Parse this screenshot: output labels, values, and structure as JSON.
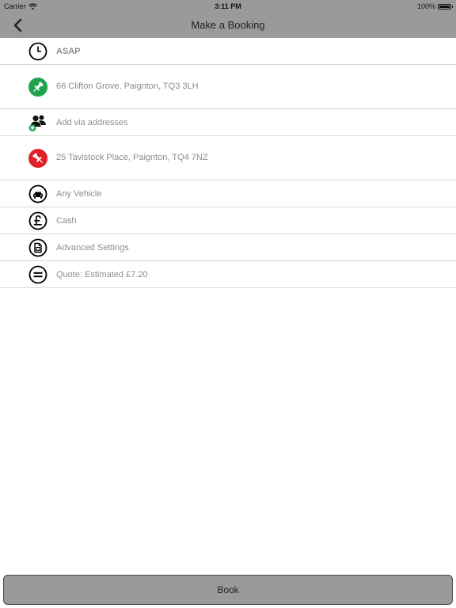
{
  "status_bar": {
    "carrier": "Carrier",
    "time": "3:11 PM",
    "battery": "100%"
  },
  "nav": {
    "title": "Make a Booking",
    "back_icon": "chevron-left-icon"
  },
  "rows": [
    {
      "name": "asap",
      "icon": "clock-icon",
      "label": "ASAP"
    },
    {
      "name": "pickup-address",
      "icon": "green-pin-icon",
      "label": "66 Clifton Grove, Paignton, TQ3 3LH"
    },
    {
      "name": "via-addresses",
      "icon": "people-add-icon",
      "label": "Add via addresses"
    },
    {
      "name": "dropoff-address",
      "icon": "red-pin-icon",
      "label": "25 Tavistock Place, Paignton, TQ4 7NZ"
    },
    {
      "name": "vehicle",
      "icon": "car-icon",
      "label": "Any Vehicle"
    },
    {
      "name": "payment",
      "icon": "pound-icon",
      "label": "Cash"
    },
    {
      "name": "advanced-settings",
      "icon": "document-icon",
      "label": "Advanced Settings"
    },
    {
      "name": "quote",
      "icon": "equals-icon",
      "label": "Quote: Estimated £7.20"
    }
  ],
  "book_button": {
    "label": "Book"
  },
  "colors": {
    "bar": "#9a9a9a",
    "pickup_pin": "#1ea34f",
    "dropoff_pin": "#e0202b",
    "row_text": "#8d8d8d",
    "divider": "#d8d8d8"
  }
}
